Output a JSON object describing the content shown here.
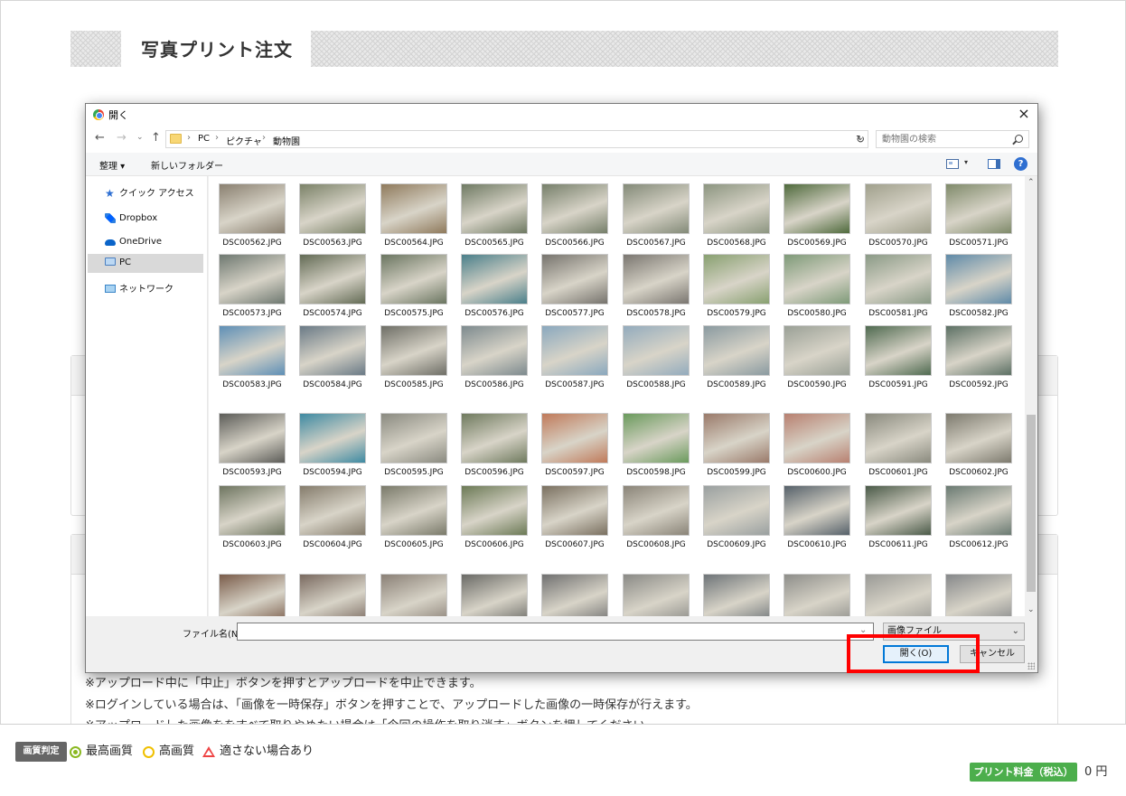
{
  "page": {
    "title": "写真プリント注文",
    "notes": [
      "※アップロード中に「中止」ボタンを押すとアップロードを中止できます。",
      "※ログインしている場合は、「画像を一時保存」ボタンを押すことで、アップロードした画像の一時保存が行えます。",
      "※アップロードした画像ををすべて取りやめたい場合は「今回の操作を取り消す」ボタンを押してください。"
    ]
  },
  "bottom_bar": {
    "quality_badge": "画質判定",
    "legend_best": "最高画質",
    "legend_high": "高画質",
    "legend_warn": "適さない場合あり",
    "price_label": "プリント料金（税込）",
    "price_value": "0 円"
  },
  "dialog": {
    "title": "開く",
    "close_glyph": "×",
    "nav": {
      "back": "←",
      "forward": "→",
      "recent": "⌄",
      "up": "↑",
      "refresh": "↻",
      "dropdown": "⌄"
    },
    "breadcrumbs": [
      "PC",
      "ピクチャ",
      "動物園"
    ],
    "crumb_separator": "›",
    "search_placeholder": "動物園の検索",
    "toolbar": {
      "organize": "整理 ▾",
      "new_folder": "新しいフォルダー",
      "help": "?",
      "view_dropdown": "▾"
    },
    "nav_pane": [
      "クイック アクセス",
      "Dropbox",
      "OneDrive",
      "PC",
      "ネットワーク"
    ],
    "scroll": {
      "up": "⌃",
      "down": "⌄"
    },
    "files": [
      {
        "name": "DSC00562.JPG",
        "color": "#8a8070"
      },
      {
        "name": "DSC00563.JPG",
        "color": "#7b8268"
      },
      {
        "name": "DSC00564.JPG",
        "color": "#8f7a5c"
      },
      {
        "name": "DSC00565.JPG",
        "color": "#6f7a63"
      },
      {
        "name": "DSC00566.JPG",
        "color": "#767f6a"
      },
      {
        "name": "DSC00567.JPG",
        "color": "#838a78"
      },
      {
        "name": "DSC00568.JPG",
        "color": "#8c9580"
      },
      {
        "name": "DSC00569.JPG",
        "color": "#4f6a3c"
      },
      {
        "name": "DSC00570.JPG",
        "color": "#a0a08c"
      },
      {
        "name": "DSC00571.JPG",
        "color": "#7f8a6a"
      },
      {
        "name": "DSC00573.JPG",
        "color": "#6e7870"
      },
      {
        "name": "DSC00574.JPG",
        "color": "#636b55"
      },
      {
        "name": "DSC00575.JPG",
        "color": "#6a7560"
      },
      {
        "name": "DSC00576.JPG",
        "color": "#4a7f8a"
      },
      {
        "name": "DSC00577.JPG",
        "color": "#76736d"
      },
      {
        "name": "DSC00578.JPG",
        "color": "#7a7670"
      },
      {
        "name": "DSC00579.JPG",
        "color": "#88a070"
      },
      {
        "name": "DSC00580.JPG",
        "color": "#7e9a78"
      },
      {
        "name": "DSC00581.JPG",
        "color": "#8a9a86"
      },
      {
        "name": "DSC00582.JPG",
        "color": "#5f8aa8"
      },
      {
        "name": "DSC00583.JPG",
        "color": "#5e8fb6"
      },
      {
        "name": "DSC00584.JPG",
        "color": "#6a7a86"
      },
      {
        "name": "DSC00585.JPG",
        "color": "#6e6e66"
      },
      {
        "name": "DSC00586.JPG",
        "color": "#7d8a8e"
      },
      {
        "name": "DSC00587.JPG",
        "color": "#8aa8be"
      },
      {
        "name": "DSC00588.JPG",
        "color": "#93abbd"
      },
      {
        "name": "DSC00589.JPG",
        "color": "#8a9aa0"
      },
      {
        "name": "DSC00590.JPG",
        "color": "#9aa096"
      },
      {
        "name": "DSC00591.JPG",
        "color": "#4f6a50"
      },
      {
        "name": "DSC00592.JPG",
        "color": "#5c7064"
      },
      {
        "name": "DSC00593.JPG",
        "color": "#5c5c58"
      },
      {
        "name": "DSC00594.JPG",
        "color": "#3e8aa2"
      },
      {
        "name": "DSC00595.JPG",
        "color": "#8a8a80"
      },
      {
        "name": "DSC00596.JPG",
        "color": "#6f7a5e"
      },
      {
        "name": "DSC00597.JPG",
        "color": "#c07a5a"
      },
      {
        "name": "DSC00598.JPG",
        "color": "#6a9a5c"
      },
      {
        "name": "DSC00599.JPG",
        "color": "#9a7a6a"
      },
      {
        "name": "DSC00600.JPG",
        "color": "#b88070"
      },
      {
        "name": "DSC00601.JPG",
        "color": "#8a8a7e"
      },
      {
        "name": "DSC00602.JPG",
        "color": "#7d7a6e"
      },
      {
        "name": "DSC00603.JPG",
        "color": "#6e7560"
      },
      {
        "name": "DSC00604.JPG",
        "color": "#857c6c"
      },
      {
        "name": "DSC00605.JPG",
        "color": "#7a7a6a"
      },
      {
        "name": "DSC00606.JPG",
        "color": "#6c7a56"
      },
      {
        "name": "DSC00607.JPG",
        "color": "#7a7060"
      },
      {
        "name": "DSC00608.JPG",
        "color": "#8a8478"
      },
      {
        "name": "DSC00609.JPG",
        "color": "#9aa0a0"
      },
      {
        "name": "DSC00610.JPG",
        "color": "#56616a"
      },
      {
        "name": "DSC00611.JPG",
        "color": "#4a5a48"
      },
      {
        "name": "DSC00612.JPG",
        "color": "#6a7a72"
      },
      {
        "name": "",
        "color": "#7a5c4a"
      },
      {
        "name": "",
        "color": "#7a6a60"
      },
      {
        "name": "",
        "color": "#8a8076"
      },
      {
        "name": "",
        "color": "#6a6a66"
      },
      {
        "name": "",
        "color": "#707070"
      },
      {
        "name": "",
        "color": "#8a8a86"
      },
      {
        "name": "",
        "color": "#6e7478"
      },
      {
        "name": "",
        "color": "#8e8e8a"
      },
      {
        "name": "",
        "color": "#9a9a96"
      },
      {
        "name": "",
        "color": "#86888a"
      }
    ],
    "filename_label": "ファイル名(N):",
    "filename_value": "",
    "filetype": "画像ファイル",
    "open_button": "開く(O)",
    "cancel_button": "キャンセル"
  }
}
